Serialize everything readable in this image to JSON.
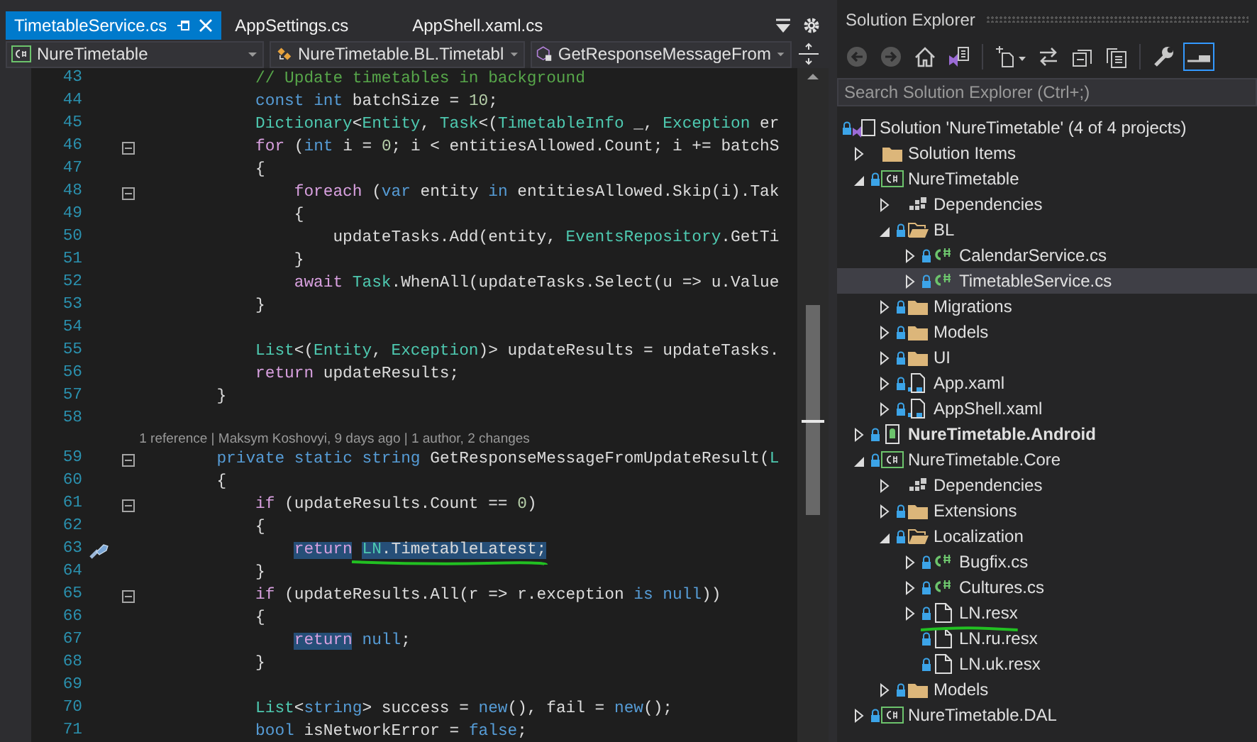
{
  "editor_tabs": [
    {
      "label": "TimetableService.cs",
      "selected": true
    },
    {
      "label": "AppSettings.cs",
      "selected": false
    },
    {
      "label": "AppShell.xaml.cs",
      "selected": false
    }
  ],
  "navigation_bar": [
    {
      "kind": "project",
      "text": "NureTimetable"
    },
    {
      "kind": "class",
      "text": "NureTimetable.BL.Timetabl"
    },
    {
      "kind": "method",
      "text": "GetResponseMessageFrom"
    }
  ],
  "code_lines": [
    {
      "kind": "code",
      "number": "43",
      "foldable": false,
      "quick_action": false,
      "tokens": [
        {
          "kind": "comment",
          "text": "            // Update timetables in background"
        }
      ]
    },
    {
      "kind": "code",
      "number": "44",
      "foldable": false,
      "quick_action": false,
      "tokens": [
        {
          "kind": "keyword",
          "text": "            const"
        },
        {
          "kind": "keyword",
          "text": " int"
        },
        {
          "kind": "plain",
          "text": " batchSize = "
        },
        {
          "kind": "number",
          "text": "10"
        },
        {
          "kind": "plain",
          "text": ";"
        }
      ]
    },
    {
      "kind": "code",
      "number": "45",
      "foldable": false,
      "quick_action": false,
      "tokens": [
        {
          "kind": "type",
          "text": "            Dictionary"
        },
        {
          "kind": "plain",
          "text": "<"
        },
        {
          "kind": "type",
          "text": "Entity"
        },
        {
          "kind": "plain",
          "text": ", "
        },
        {
          "kind": "type",
          "text": "Task"
        },
        {
          "kind": "plain",
          "text": "<("
        },
        {
          "kind": "type",
          "text": "TimetableInfo"
        },
        {
          "kind": "plain",
          "text": " _, "
        },
        {
          "kind": "type",
          "text": "Exception"
        },
        {
          "kind": "plain",
          "text": " er"
        }
      ]
    },
    {
      "kind": "code",
      "number": "46",
      "foldable": true,
      "quick_action": false,
      "tokens": [
        {
          "kind": "control",
          "text": "            for"
        },
        {
          "kind": "plain",
          "text": " ("
        },
        {
          "kind": "keyword",
          "text": "int"
        },
        {
          "kind": "plain",
          "text": " i = "
        },
        {
          "kind": "number",
          "text": "0"
        },
        {
          "kind": "plain",
          "text": "; i < entitiesAllowed.Count; i += batchS"
        }
      ]
    },
    {
      "kind": "code",
      "number": "47",
      "foldable": false,
      "quick_action": false,
      "tokens": [
        {
          "kind": "plain",
          "text": "            {"
        }
      ]
    },
    {
      "kind": "code",
      "number": "48",
      "foldable": true,
      "quick_action": false,
      "tokens": [
        {
          "kind": "control",
          "text": "                foreach"
        },
        {
          "kind": "plain",
          "text": " ("
        },
        {
          "kind": "keyword",
          "text": "var"
        },
        {
          "kind": "plain",
          "text": " entity "
        },
        {
          "kind": "keyword",
          "text": "in"
        },
        {
          "kind": "plain",
          "text": " entitiesAllowed.Skip(i).Tak"
        }
      ]
    },
    {
      "kind": "code",
      "number": "49",
      "foldable": false,
      "quick_action": false,
      "tokens": [
        {
          "kind": "plain",
          "text": "                {"
        }
      ]
    },
    {
      "kind": "code",
      "number": "50",
      "foldable": false,
      "quick_action": false,
      "tokens": [
        {
          "kind": "plain",
          "text": "                    updateTasks.Add(entity, "
        },
        {
          "kind": "type",
          "text": "EventsRepository"
        },
        {
          "kind": "plain",
          "text": ".GetTi"
        }
      ]
    },
    {
      "kind": "code",
      "number": "51",
      "foldable": false,
      "quick_action": false,
      "tokens": [
        {
          "kind": "plain",
          "text": "                }"
        }
      ]
    },
    {
      "kind": "code",
      "number": "52",
      "foldable": false,
      "quick_action": false,
      "tokens": [
        {
          "kind": "control",
          "text": "                await"
        },
        {
          "kind": "type",
          "text": " Task"
        },
        {
          "kind": "plain",
          "text": ".WhenAll(updateTasks.Select(u => u.Value"
        }
      ]
    },
    {
      "kind": "code",
      "number": "53",
      "foldable": false,
      "quick_action": false,
      "tokens": [
        {
          "kind": "plain",
          "text": "            }"
        }
      ]
    },
    {
      "kind": "code",
      "number": "54",
      "foldable": false,
      "quick_action": false
    },
    {
      "kind": "code",
      "number": "55",
      "foldable": false,
      "quick_action": false,
      "tokens": [
        {
          "kind": "type",
          "text": "            List"
        },
        {
          "kind": "plain",
          "text": "<("
        },
        {
          "kind": "type",
          "text": "Entity"
        },
        {
          "kind": "plain",
          "text": ", "
        },
        {
          "kind": "type",
          "text": "Exception"
        },
        {
          "kind": "plain",
          "text": ")> updateResults = updateTasks."
        }
      ]
    },
    {
      "kind": "code",
      "number": "56",
      "foldable": false,
      "quick_action": false,
      "tokens": [
        {
          "kind": "control",
          "text": "            return"
        },
        {
          "kind": "plain",
          "text": " updateResults;"
        }
      ]
    },
    {
      "kind": "code",
      "number": "57",
      "foldable": false,
      "quick_action": false,
      "tokens": [
        {
          "kind": "plain",
          "text": "        }"
        }
      ]
    },
    {
      "kind": "code",
      "number": "58",
      "foldable": false,
      "quick_action": false
    },
    {
      "kind": "codelens",
      "text": "1 reference | Maksym Koshovyi, 9 days ago | 1 author, 2 changes"
    },
    {
      "kind": "code",
      "number": "59",
      "foldable": true,
      "quick_action": false,
      "tokens": [
        {
          "kind": "keyword",
          "text": "        private"
        },
        {
          "kind": "keyword",
          "text": " static"
        },
        {
          "kind": "keyword",
          "text": " string"
        },
        {
          "kind": "plain",
          "text": " GetResponseMessageFromUpdateResult("
        },
        {
          "kind": "type",
          "text": "L"
        }
      ]
    },
    {
      "kind": "code",
      "number": "60",
      "foldable": false,
      "quick_action": false,
      "tokens": [
        {
          "kind": "plain",
          "text": "        {"
        }
      ]
    },
    {
      "kind": "code",
      "number": "61",
      "foldable": true,
      "quick_action": false,
      "tokens": [
        {
          "kind": "control",
          "text": "            if"
        },
        {
          "kind": "plain",
          "text": " (updateResults.Count == "
        },
        {
          "kind": "number",
          "text": "0"
        },
        {
          "kind": "plain",
          "text": ")"
        }
      ]
    },
    {
      "kind": "code",
      "number": "62",
      "foldable": false,
      "quick_action": false,
      "tokens": [
        {
          "kind": "plain",
          "text": "            {"
        }
      ]
    },
    {
      "kind": "code",
      "number": "63",
      "foldable": false,
      "quick_action": true,
      "tokens": [
        {
          "kind": "control",
          "text": "                return",
          "highlighted": true
        },
        {
          "kind": "type",
          "text": " LN",
          "highlighted": true,
          "underlined": true
        },
        {
          "kind": "plain",
          "text": ".TimetableLatest;",
          "highlighted": true,
          "underlined": true
        }
      ]
    },
    {
      "kind": "code",
      "number": "64",
      "foldable": false,
      "quick_action": false,
      "tokens": [
        {
          "kind": "plain",
          "text": "            }"
        }
      ]
    },
    {
      "kind": "code",
      "number": "65",
      "foldable": true,
      "quick_action": false,
      "tokens": [
        {
          "kind": "control",
          "text": "            if"
        },
        {
          "kind": "plain",
          "text": " (updateResults.All(r => r.exception "
        },
        {
          "kind": "keyword",
          "text": "is"
        },
        {
          "kind": "keyword",
          "text": " null"
        },
        {
          "kind": "plain",
          "text": "))"
        }
      ]
    },
    {
      "kind": "code",
      "number": "66",
      "foldable": false,
      "quick_action": false,
      "tokens": [
        {
          "kind": "plain",
          "text": "            {"
        }
      ]
    },
    {
      "kind": "code",
      "number": "67",
      "foldable": false,
      "quick_action": false,
      "tokens": [
        {
          "kind": "control",
          "text": "                return",
          "highlighted": true
        },
        {
          "kind": "keyword",
          "text": " null"
        },
        {
          "kind": "plain",
          "text": ";"
        }
      ]
    },
    {
      "kind": "code",
      "number": "68",
      "foldable": false,
      "quick_action": false,
      "tokens": [
        {
          "kind": "plain",
          "text": "            }"
        }
      ]
    },
    {
      "kind": "code",
      "number": "69",
      "foldable": false,
      "quick_action": false
    },
    {
      "kind": "code",
      "number": "70",
      "foldable": false,
      "quick_action": false,
      "tokens": [
        {
          "kind": "type",
          "text": "            List"
        },
        {
          "kind": "plain",
          "text": "<"
        },
        {
          "kind": "keyword",
          "text": "string"
        },
        {
          "kind": "plain",
          "text": "> success = "
        },
        {
          "kind": "keyword",
          "text": "new"
        },
        {
          "kind": "plain",
          "text": "(), fail = "
        },
        {
          "kind": "keyword",
          "text": "new"
        },
        {
          "kind": "plain",
          "text": "();"
        }
      ]
    },
    {
      "kind": "code",
      "number": "71",
      "foldable": false,
      "quick_action": false,
      "tokens": [
        {
          "kind": "keyword",
          "text": "            bool"
        },
        {
          "kind": "plain",
          "text": " isNetworkError = "
        },
        {
          "kind": "keyword",
          "text": "false"
        },
        {
          "kind": "plain",
          "text": ";"
        }
      ]
    }
  ],
  "solution_explorer": {
    "title": "Solution Explorer",
    "toolbar": [
      [
        {
          "kind": "back",
          "disabled": true,
          "on": false
        },
        {
          "kind": "forward",
          "disabled": true,
          "on": false
        },
        {
          "kind": "home",
          "disabled": false,
          "on": false
        },
        {
          "kind": "switch-views",
          "disabled": false,
          "on": false
        }
      ],
      [
        {
          "kind": "new-item",
          "disabled": false,
          "on": false
        },
        {
          "kind": "sync",
          "disabled": false,
          "on": false
        },
        {
          "kind": "collapse-all",
          "disabled": false,
          "on": false
        },
        {
          "kind": "copy",
          "disabled": false,
          "on": false
        }
      ],
      [
        {
          "kind": "properties",
          "disabled": false,
          "on": false
        },
        {
          "kind": "auto-hide",
          "disabled": false,
          "on": true
        }
      ]
    ],
    "search": {
      "placeholder": "Search Solution Explorer (Ctrl+;)"
    },
    "tree": [
      {
        "label": "Solution 'NureTimetable' (4 of 4 projects)",
        "kind": "solution",
        "locked": true,
        "selected": false,
        "children": [
          {
            "label": "Solution Items",
            "kind": "folder",
            "locked": false,
            "expanded": false,
            "selected": false
          },
          {
            "label": "NureTimetable",
            "kind": "csproj",
            "locked": true,
            "expanded": true,
            "selected": false,
            "children": [
              {
                "label": "Dependencies",
                "kind": "dependencies",
                "locked": false,
                "expanded": false,
                "selected": false
              },
              {
                "label": "BL",
                "kind": "folder",
                "locked": true,
                "expanded": true,
                "selected": false,
                "children": [
                  {
                    "label": "CalendarService.cs",
                    "kind": "cs",
                    "locked": true,
                    "expanded": false,
                    "selected": false
                  },
                  {
                    "label": "TimetableService.cs",
                    "kind": "cs",
                    "locked": true,
                    "expanded": false,
                    "selected": true
                  }
                ]
              },
              {
                "label": "Migrations",
                "kind": "folder",
                "locked": true,
                "expanded": false,
                "selected": false
              },
              {
                "label": "Models",
                "kind": "folder",
                "locked": true,
                "expanded": false,
                "selected": false
              },
              {
                "label": "UI",
                "kind": "folder",
                "locked": true,
                "expanded": false,
                "selected": false
              },
              {
                "label": "App.xaml",
                "kind": "xaml",
                "locked": true,
                "expanded": false,
                "selected": false
              },
              {
                "label": "AppShell.xaml",
                "kind": "xaml",
                "locked": true,
                "expanded": false,
                "selected": false
              }
            ]
          },
          {
            "label": "NureTimetable.Android",
            "kind": "android",
            "locked": true,
            "expanded": false,
            "selected": false,
            "startup": true
          },
          {
            "label": "NureTimetable.Core",
            "kind": "csproj",
            "locked": true,
            "expanded": true,
            "selected": false,
            "children": [
              {
                "label": "Dependencies",
                "kind": "dependencies",
                "locked": false,
                "expanded": false,
                "selected": false
              },
              {
                "label": "Extensions",
                "kind": "folder",
                "locked": true,
                "expanded": false,
                "selected": false
              },
              {
                "label": "Localization",
                "kind": "folder",
                "locked": true,
                "expanded": true,
                "selected": false,
                "children": [
                  {
                    "label": "Bugfix.cs",
                    "kind": "cs",
                    "locked": true,
                    "expanded": false,
                    "selected": false
                  },
                  {
                    "label": "Cultures.cs",
                    "kind": "cs",
                    "locked": true,
                    "expanded": false,
                    "selected": false
                  },
                  {
                    "label": "LN.resx",
                    "kind": "resx",
                    "locked": true,
                    "expanded": false,
                    "selected": false,
                    "underlined": true
                  },
                  {
                    "label": "LN.ru.resx",
                    "kind": "resx",
                    "locked": true,
                    "selected": false
                  },
                  {
                    "label": "LN.uk.resx",
                    "kind": "resx",
                    "locked": true,
                    "selected": false
                  }
                ]
              },
              {
                "label": "Models",
                "kind": "folder",
                "locked": true,
                "expanded": false,
                "selected": false
              }
            ]
          },
          {
            "label": "NureTimetable.DAL",
            "kind": "csproj",
            "locked": true,
            "expanded": false,
            "selected": false
          }
        ]
      }
    ]
  }
}
